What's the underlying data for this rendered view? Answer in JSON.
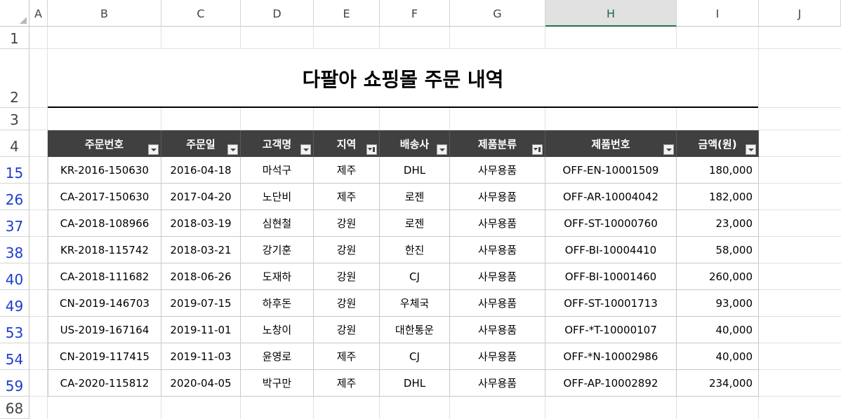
{
  "columns": [
    "A",
    "B",
    "C",
    "D",
    "E",
    "F",
    "G",
    "H",
    "I",
    "J"
  ],
  "selected_column": "H",
  "row_numbers": [
    "1",
    "2",
    "3",
    "4",
    "15",
    "26",
    "37",
    "38",
    "40",
    "49",
    "53",
    "54",
    "59",
    "68"
  ],
  "title": "다팔아 쇼핑몰 주문 내역",
  "table": {
    "headers": [
      "주문번호",
      "주문일",
      "고객명",
      "지역",
      "배송사",
      "제품분류",
      "제품번호",
      "금액(원)"
    ],
    "filtered_columns": [
      "지역",
      "제품분류"
    ],
    "rows": [
      [
        "KR-2016-150630",
        "2016-04-18",
        "마석구",
        "제주",
        "DHL",
        "사무용품",
        "OFF-EN-10001509",
        "180,000"
      ],
      [
        "CA-2017-150630",
        "2017-04-20",
        "노단비",
        "제주",
        "로젠",
        "사무용품",
        "OFF-AR-10004042",
        "182,000"
      ],
      [
        "CA-2018-108966",
        "2018-03-19",
        "심현철",
        "강원",
        "로젠",
        "사무용품",
        "OFF-ST-10000760",
        "23,000"
      ],
      [
        "KR-2018-115742",
        "2018-03-21",
        "강기훈",
        "강원",
        "한진",
        "사무용품",
        "OFF-BI-10004410",
        "58,000"
      ],
      [
        "CA-2018-111682",
        "2018-06-26",
        "도재하",
        "강원",
        "CJ",
        "사무용품",
        "OFF-BI-10001460",
        "260,000"
      ],
      [
        "CN-2019-146703",
        "2019-07-15",
        "하후돈",
        "강원",
        "우체국",
        "사무용품",
        "OFF-ST-10001713",
        "93,000"
      ],
      [
        "US-2019-167164",
        "2019-11-01",
        "노창이",
        "강원",
        "대한통운",
        "사무용품",
        "OFF-*T-10000107",
        "40,000"
      ],
      [
        "CN-2019-117415",
        "2019-11-03",
        "윤영로",
        "제주",
        "CJ",
        "사무용품",
        "OFF-*N-10002986",
        "40,000"
      ],
      [
        "CA-2020-115812",
        "2020-04-05",
        "박구만",
        "제주",
        "DHL",
        "사무용품",
        "OFF-AP-10002892",
        "234,000"
      ]
    ]
  },
  "icons": {
    "filter": "dropdown-arrow-icon",
    "filter_active": "filter-funnel-icon"
  },
  "colors": {
    "header_bg": "#404040",
    "filtered_row_number": "#1e3ccf",
    "selected_column": "#217346"
  }
}
